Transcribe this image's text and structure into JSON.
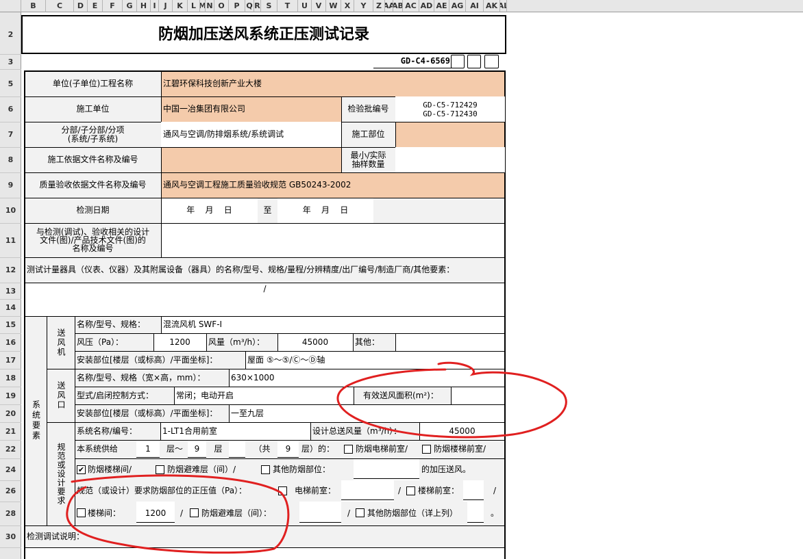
{
  "columns": [
    "B",
    "C",
    "D",
    "E",
    "F",
    "G",
    "H",
    "I",
    "J",
    "K",
    "L",
    "M",
    "N",
    "O",
    "P",
    "Q",
    "R",
    "S",
    "T",
    "U",
    "V",
    "W",
    "X",
    "Y",
    "Z",
    "AA",
    "AB",
    "AC",
    "AD",
    "AE",
    "AG",
    "AI",
    "AK",
    "AL"
  ],
  "rows": {
    "r2": "2",
    "r3": "3",
    "r5": "5",
    "r6": "6",
    "r7": "7",
    "r8": "8",
    "r9": "9",
    "r10": "10",
    "r11": "11",
    "r12": "12",
    "r13": "13",
    "r14": "14",
    "r15": "15",
    "r16": "16",
    "r17": "17",
    "r18": "18",
    "r19": "19",
    "r20": "20",
    "r21": "21",
    "r22": "22",
    "r24": "24",
    "r26": "26",
    "r28": "28",
    "r30": "30"
  },
  "title": "防烟加压送风系统正压测试记录",
  "doc_code": "GD-C4-6569",
  "labels": {
    "unit_project": "单位(子单位)工程名称",
    "construction_unit": "施工单位",
    "inspection_batch_no": "检验批编号",
    "division_line1": "分部/子分部/分项",
    "division_line2": "(系统/子系统)",
    "construction_part": "施工部位",
    "basis_doc": "施工依据文件名称及编号",
    "sample_line1": "最小/实际",
    "sample_line2": "抽样数量",
    "acceptance_basis": "质量验收依据文件名称及编号",
    "test_date": "检测日期",
    "design_docs_line1": "与检测(调试)、验收相关的设计",
    "design_docs_line2": "文件(图)/产品技术文件(图)的",
    "design_docs_line3": "名称及编号",
    "instruments": "测试计量器具（仪表、仪器）及其附属设备（器具）的名称/型号、规格/量程/分辨精度/出厂编号/制造厂商/其他要素：",
    "system_elements": "系统要素",
    "fan": "送风机",
    "outlet": "送风口",
    "spec_req": "规范或设计要求",
    "test_notes": "检测调试说明："
  },
  "values": {
    "unit_project": "江碧环保科技创新产业大楼",
    "construction_unit": "中国一冶集团有限公司",
    "batch_no_1": "GD-C5-712429",
    "batch_no_2": "GD-C5-712430",
    "division": "通风与空调/防排烟系统/系统调试",
    "acceptance_basis": "通风与空调工程施工质量验收规范  GB50243-2002",
    "date_ymd_1": "年    月    日",
    "date_to": "至",
    "date_ymd_2": "年    月    日",
    "instruments_value": "/"
  },
  "fan": {
    "model_label": "名称/型号、规格：",
    "model_value": "混流风机 SWF-Ⅰ",
    "pressure_label": "风压（Pa）：",
    "pressure_value": "1200",
    "airflow_label": "风量（m³/h）：",
    "airflow_value": "45000",
    "other_label": "其他：",
    "location_label": "安装部位[楼层（或标高）/平面坐标]：",
    "location_value": "屋面 ⑤～⑤/Ⓒ～Ⓓ轴"
  },
  "outlet": {
    "model_label": "名称/型号、规格（宽×高，mm）：",
    "model_value": "630×1000",
    "control_label": "型式/启闭控制方式：",
    "control_value": "常闭；电动开启",
    "area_label": "有效送风面积(m²)：",
    "location_label": "安装部位[楼层（或标高）/平面坐标]：",
    "location_value": "一至九层"
  },
  "spec": {
    "system_label": "系统名称/编号：",
    "system_value": "1-LT1合用前室",
    "design_airflow_label": "设计总送风量（m³/h）：",
    "design_airflow_value": "45000",
    "supply_prefix": "本系统供给",
    "floor_from": "1",
    "floor_mid": "层～",
    "floor_to": "9",
    "floor_end": "层",
    "total_open": "（共",
    "floor_total": "9",
    "total_close": "层）的：",
    "elevator_lobby": "防烟电梯前室/",
    "stair_lobby": "防烟楼梯前室/",
    "stairwell": "防烟楼梯间/",
    "refuge_floor": "防烟避难层（间）/",
    "other_parts": "其他防烟部位：",
    "pressurize_suffix": "的加压送风。",
    "pressure_req_label": "规范（或设计）要求防烟部位的正压值（Pa）：",
    "elevator_lobby_2": "电梯前室：",
    "stair_lobby_2": "楼梯前室：",
    "stairwell_2": "楼梯间：",
    "stairwell_2_value": "1200",
    "refuge_2": "防烟避难层（间）：",
    "other_2": "其他防烟部位（详上列）",
    "slash": "/",
    "dot": "。",
    "check_mark": "✔"
  }
}
